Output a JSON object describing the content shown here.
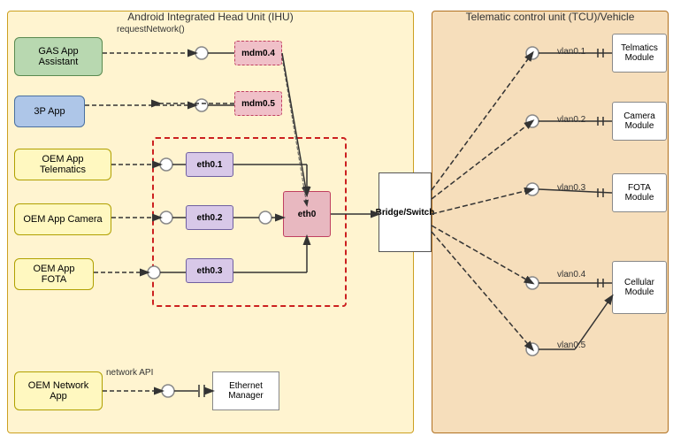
{
  "ihu": {
    "title": "Android Integrated Head Unit (IHU)",
    "apps": {
      "gas": "GAS App Assistant",
      "threep": "3P App",
      "oem_telematics": "OEM App Telematics",
      "oem_camera": "OEM App Camera",
      "oem_fota": "OEM App FOTA",
      "oem_network": "OEM Network App"
    },
    "ports": {
      "mdm04": "mdm0.4",
      "mdm05": "mdm0.5",
      "eth01": "eth0.1",
      "eth02": "eth0.2",
      "eth03": "eth0.3",
      "eth0": "eth0"
    },
    "labels": {
      "request_network": "requestNetwork()",
      "network_api": "network API"
    },
    "bridge": "Bridge/Switch",
    "eth_manager": "Ethernet\nManager"
  },
  "tcu": {
    "title": "Telematic control unit (TCU)/Vehicle",
    "ports": {
      "vlan01": "vlan0.1",
      "vlan02": "vlan0.2",
      "vlan03": "vlan0.3",
      "vlan04": "vlan0.4",
      "vlan05": "vlan0.5"
    },
    "modules": {
      "telmatics": "Telmatics\nModule",
      "camera": "Camera\nModule",
      "fota": "FOTA\nModule",
      "cellular": "Cellular\nModule"
    }
  }
}
